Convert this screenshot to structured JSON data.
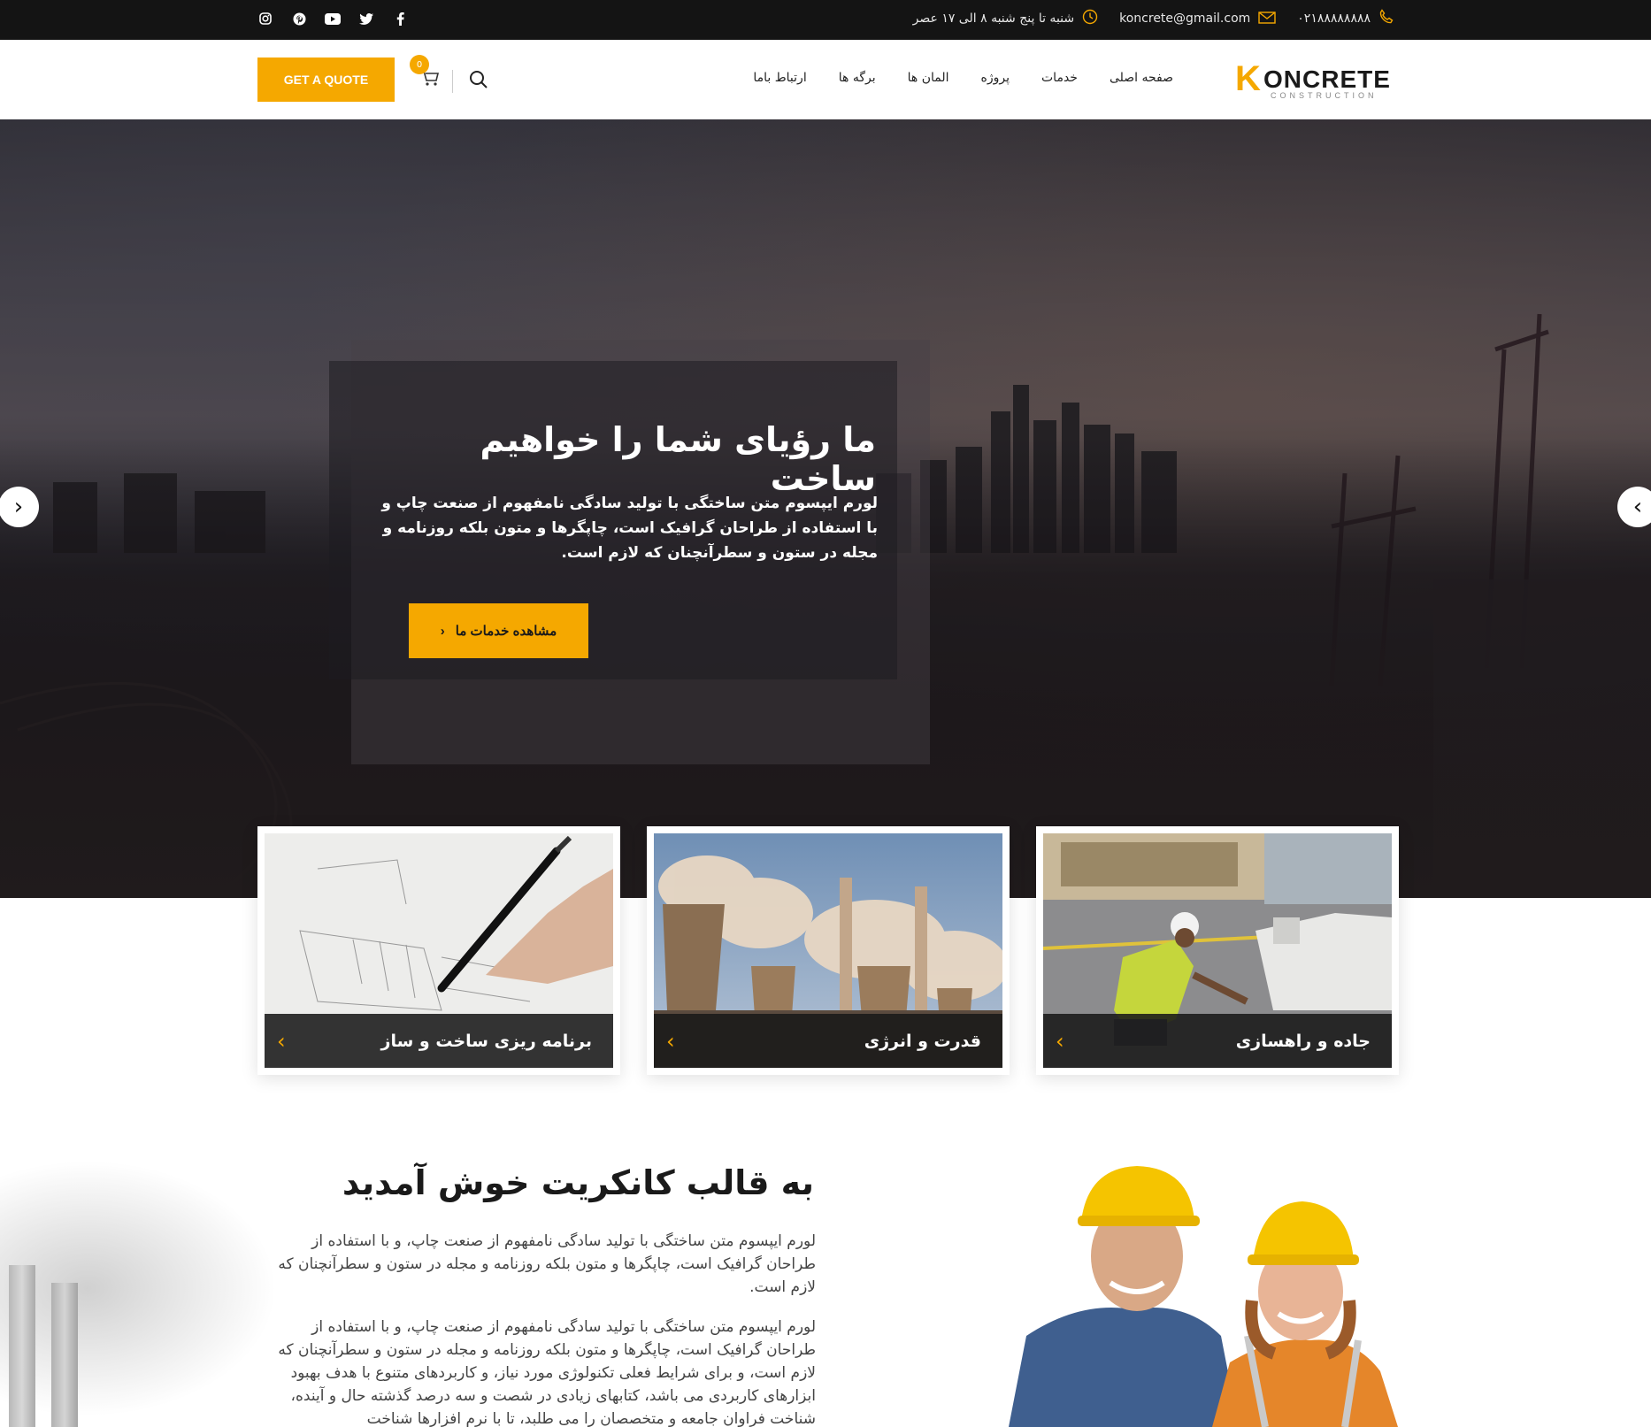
{
  "topbar": {
    "phone": "۰۲۱۸۸۸۸۸۸۸۸",
    "email": "koncrete@gmail.com",
    "hours": "شنبه تا پنج شنبه ۸ الی ۱۷ عصر",
    "social_icons": [
      "instagram-icon",
      "pinterest-icon",
      "youtube-icon",
      "twitter-icon",
      "facebook-icon"
    ]
  },
  "header": {
    "logo_letter": "K",
    "logo_rest": "ONCRETE",
    "logo_sub": "CONSTRUCTION",
    "nav": [
      "صفحه اصلی",
      "خدمات",
      "پروژه",
      "المان ها",
      "برگه ها",
      "ارتباط باما"
    ],
    "cart_count": "0",
    "quote_label": "GET A QUOTE"
  },
  "hero": {
    "title": "ما رؤیای شما را خواهیم ساخت",
    "text": "لورم ایپسوم متن ساختگی با تولید سادگی نامفهوم از صنعت چاپ و با استفاده از طراحان گرافیک است، چاپگرها و متون بلکه روزنامه و مجله در ستون و سطرآنچنان که لازم است.",
    "button": "مشاهده خدمات ما"
  },
  "cards": [
    {
      "title": "برنامه ریزی ساخت و ساز"
    },
    {
      "title": "قدرت و انرژی"
    },
    {
      "title": "جاده و راهسازی"
    }
  ],
  "welcome": {
    "title": "به قالب کانکریت خوش آمدید",
    "p1": "لورم ایپسوم متن ساختگی با تولید سادگی نامفهوم از صنعت چاپ، و با استفاده از طراحان گرافیک است، چاپگرها و متون بلکه روزنامه و مجله در ستون و سطرآنچنان که لازم است.",
    "p2": "لورم ایپسوم متن ساختگی با تولید سادگی نامفهوم از صنعت چاپ، و با استفاده از طراحان گرافیک است، چاپگرها و متون بلکه روزنامه و مجله در ستون و سطرآنچنان که لازم است، و برای شرایط فعلی تکنولوژی مورد نیاز، و کاربردهای متنوع با هدف بهبود ابزارهای کاربردی می باشد، کتابهای زیادی در شصت و سه درصد گذشته حال و آینده، شناخت فراوان جامعه و متخصصان را می طلبد، تا با نرم افزارها شناخت"
  },
  "colors": {
    "accent": "#f5a800",
    "topbar": "#141414"
  }
}
